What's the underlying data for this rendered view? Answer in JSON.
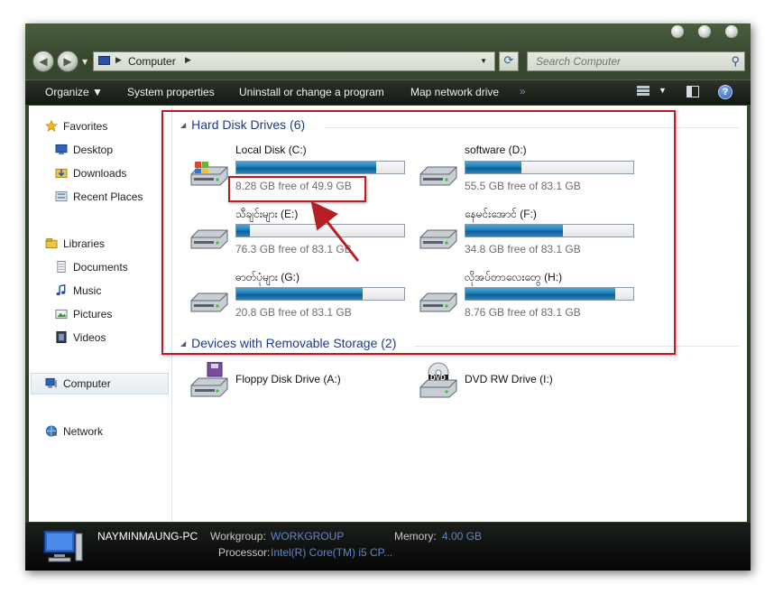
{
  "address": {
    "crumb": "Computer"
  },
  "search": {
    "placeholder": "Search Computer"
  },
  "toolbar": {
    "organize": "Organize",
    "system_properties": "System properties",
    "uninstall": "Uninstall or change a program",
    "map_drive": "Map network drive",
    "more": "»"
  },
  "nav": {
    "favorites": "Favorites",
    "desktop": "Desktop",
    "downloads": "Downloads",
    "recent_places": "Recent Places",
    "libraries": "Libraries",
    "documents": "Documents",
    "music": "Music",
    "pictures": "Pictures",
    "videos": "Videos",
    "computer": "Computer",
    "network": "Network"
  },
  "groups": {
    "hard_disks": "Hard Disk Drives (6)",
    "removable": "Devices with Removable Storage (2)"
  },
  "drives": [
    {
      "name": "Local Disk (C:)",
      "free": "8.28 GB free of 49.9 GB",
      "used_fraction": 0.834,
      "icon": "windows-drive-icon"
    },
    {
      "name": "software (D:)",
      "free": "55.5 GB free of 83.1 GB",
      "used_fraction": 0.332,
      "icon": "hard-drive-icon"
    },
    {
      "name": "သီချင်းများ (E:)",
      "free": "76.3 GB free of 83.1 GB",
      "used_fraction": 0.082,
      "icon": "hard-drive-icon"
    },
    {
      "name": "နေမင်းအောင် (F:)",
      "free": "34.8 GB free of 83.1 GB",
      "used_fraction": 0.581,
      "icon": "hard-drive-icon"
    },
    {
      "name": "ဓာတ်ပုံများ (G:)",
      "free": "20.8 GB free of 83.1 GB",
      "used_fraction": 0.75,
      "icon": "hard-drive-icon"
    },
    {
      "name": "လိုအပ်တာလေးတွေ (H:)",
      "free": "8.76 GB free of 83.1 GB",
      "used_fraction": 0.895,
      "icon": "hard-drive-icon"
    }
  ],
  "removable": [
    {
      "name": "Floppy Disk Drive (A:)",
      "icon": "floppy-drive-icon"
    },
    {
      "name": "DVD RW Drive (I:)",
      "icon": "dvd-drive-icon",
      "badge": "DVD"
    }
  ],
  "status": {
    "pc_name": "NAYMINMAUNG-PC",
    "workgroup_label": "Workgroup:",
    "workgroup_value": "WORKGROUP",
    "memory_label": "Memory:",
    "memory_value": "4.00 GB",
    "processor_label": "Processor:",
    "processor_value": "Intel(R) Core(TM) i5 CP..."
  },
  "colors": {
    "accent": "#1e3a8a",
    "highlight_box": "#b51f24",
    "status_value": "#5f86c8"
  }
}
